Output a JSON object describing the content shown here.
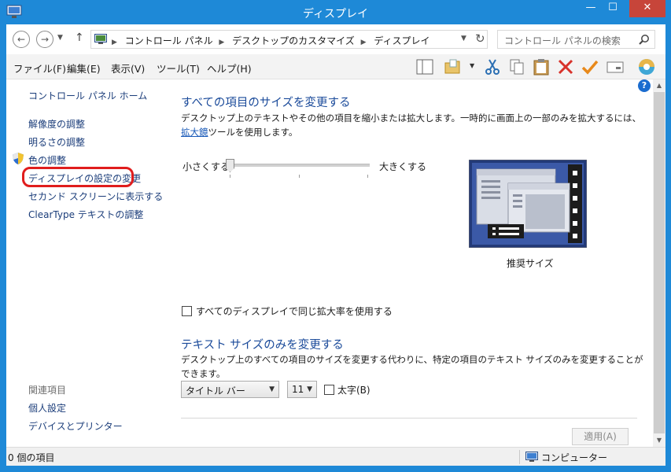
{
  "window": {
    "title": "ディスプレイ",
    "minimize_glyph": "—",
    "maximize_glyph": "☐",
    "close_glyph": "✕"
  },
  "address_bar": {
    "crumbs": [
      "コントロール パネル",
      "デスクトップのカスタマイズ",
      "ディスプレイ"
    ],
    "separator": "▶"
  },
  "search": {
    "placeholder": "コントロール パネルの検索"
  },
  "menu": {
    "file": "ファイル(F)",
    "edit": "編集(E)",
    "view": "表示(V)",
    "tools": "ツール(T)",
    "help": "ヘルプ(H)"
  },
  "toolbar_icons": [
    "pane-icon",
    "folder-icon",
    "cut-icon",
    "copy-icon",
    "paste-icon",
    "delete-icon",
    "check-icon",
    "properties-icon",
    "shell-icon"
  ],
  "left_nav": {
    "home": "コントロール パネル ホーム",
    "links": [
      "解像度の調整",
      "明るさの調整",
      "色の調整",
      "ディスプレイの設定の変更",
      "セカンド スクリーンに表示する",
      "ClearType テキストの調整"
    ],
    "related_heading": "関連項目",
    "related_links": [
      "個人設定",
      "デバイスとプリンター"
    ]
  },
  "main": {
    "section1_title": "すべての項目のサイズを変更する",
    "section1_desc_before": "デスクトップ上のテキストやその他の項目を縮小または拡大します。一時的に画面上の一部のみを拡大するには、",
    "section1_desc_link": "拡大鏡",
    "section1_desc_after": "ツールを使用します。",
    "slider_min_label": "小さくする",
    "slider_max_label": "大きくする",
    "slider_value_fraction": 0.0,
    "preview_caption": "推奨サイズ",
    "same_scale_checkbox_label": "すべてのディスプレイで同じ拡大率を使用する",
    "same_scale_checked": false,
    "section2_title": "テキスト サイズのみを変更する",
    "section2_desc": "デスクトップ上のすべての項目のサイズを変更する代わりに、特定の項目のテキスト サイズのみを変更することができます。",
    "item_select_value": "タイトル バー",
    "size_select_value": "11",
    "bold_label": "太字(B)",
    "bold_checked": false,
    "apply_button": "適用(A)"
  },
  "status_bar": {
    "items_count": "0 個の項目",
    "location": "コンピューター"
  }
}
